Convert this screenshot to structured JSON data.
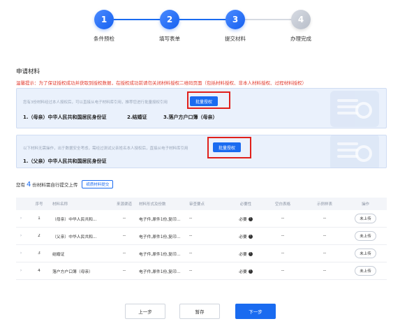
{
  "stepper": {
    "steps": [
      {
        "num": "1",
        "label": "条件预检",
        "state": "done"
      },
      {
        "num": "2",
        "label": "填写表单",
        "state": "done"
      },
      {
        "num": "3",
        "label": "提交材料",
        "state": "current"
      },
      {
        "num": "4",
        "label": "办理完成",
        "state": "pending"
      }
    ]
  },
  "section": {
    "title": "申请材料",
    "warning": "温馨提示：为了保证授权成功并获取到授权数据，在授权成功前请勿关闭材料授权二维码页面（包括材料授权、非本人材料授权、过程材料授权）"
  },
  "box1": {
    "hint": "您有3份材料经过本人授权后，可以直接从电子材料库引用，推荐您进行批量授权引用",
    "button": "批量授权",
    "docs": [
      "1.（母亲）中华人民共和国居民身份证",
      "2.结婚证",
      "3.落户方户口簿（母亲）"
    ]
  },
  "box2": {
    "hint": "以下材料无需操作，出于数据安全考虑，需经过测试父亲姓名本人授权后，直接从电子材料库引用",
    "button": "批量授权",
    "docs": [
      "1.（父亲）中华人民共和国居民身份证"
    ]
  },
  "upload": {
    "prefix": "您有",
    "count": "4",
    "suffix": "份材料需自行提交上传",
    "paper_button": "纸质材料提交"
  },
  "table": {
    "headers": [
      "序号",
      "材料名称",
      "来源渠道",
      "材料形式及份数",
      "审查要点",
      "必要性",
      "空白表格",
      "示例样表",
      "操作"
    ],
    "rows": [
      {
        "no": "1",
        "name": "（母亲）中华人民共和...",
        "channel": "--",
        "form": "电子件,原件1份,复印...",
        "review": "--",
        "req": "必要",
        "blank": "--",
        "sample": "--",
        "action": "未上传"
      },
      {
        "no": "2",
        "name": "（父亲）中华人民共和...",
        "channel": "--",
        "form": "电子件,原件1份,复印...",
        "review": "--",
        "req": "必要",
        "blank": "--",
        "sample": "--",
        "action": "未上传"
      },
      {
        "no": "3",
        "name": "结婚证",
        "channel": "--",
        "form": "电子件,原件1份,复印...",
        "review": "--",
        "req": "必要",
        "blank": "--",
        "sample": "--",
        "action": "未上传"
      },
      {
        "no": "4",
        "name": "落户方户口簿（母亲）",
        "channel": "--",
        "form": "电子件,原件1份,复印...",
        "review": "--",
        "req": "必要",
        "blank": "--",
        "sample": "--",
        "action": "未上传"
      }
    ]
  },
  "footer": {
    "prev": "上一步",
    "save": "暂存",
    "next": "下一步"
  },
  "colors": {
    "primary": "#1a6bf0",
    "warning": "#e23b2e",
    "highlight": "#e0201b"
  }
}
